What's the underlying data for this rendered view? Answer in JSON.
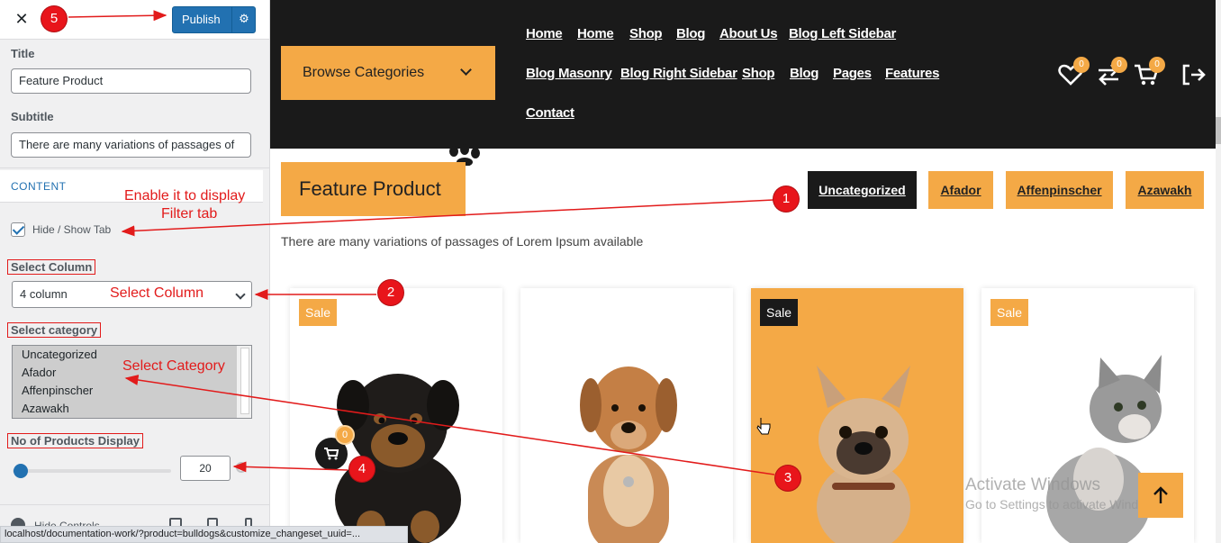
{
  "customizer": {
    "publish_label": "Publish",
    "title_label": "Title",
    "title_value": "Feature Product",
    "subtitle_label": "Subtitle",
    "subtitle_value": "There are many variations of passages of",
    "section_label": "CONTENT",
    "hide_show_tab_label": "Hide / Show Tab",
    "hide_show_tab_checked": true,
    "select_column_label": "Select Column",
    "select_column_value": "4 column",
    "select_category_label": "Select category",
    "categories": [
      "Uncategorized",
      "Afador",
      "Affenpinscher",
      "Azawakh"
    ],
    "products_display_label": "No of Products Display",
    "products_display_value": "20",
    "products_display_slider_fraction": 0.05,
    "hide_controls_label": "Hide Controls"
  },
  "annotations": {
    "badges": [
      "1",
      "2",
      "3",
      "4",
      "5"
    ],
    "enable_tab_line1": "Enable it to display",
    "enable_tab_line2": "Filter tab",
    "select_column_text": "Select Column",
    "select_category_text": "Select Category"
  },
  "status_url": "localhost/documentation-work/?product=bulldogs&customize_changeset_uuid=...",
  "preview": {
    "browse_label": "Browse Categories",
    "nav_row1": [
      "Home",
      "Home",
      "Shop",
      "Blog",
      "About Us",
      "Blog Left Sidebar"
    ],
    "nav_row2": [
      "Blog Masonry",
      "Blog Right Sidebar",
      "Shop",
      "Blog",
      "Pages",
      "Features"
    ],
    "nav_row3": [
      "Contact"
    ],
    "wishlist_count": "0",
    "compare_count": "0",
    "cart_count": "0",
    "section_title": "Feature Product",
    "section_subtitle": "There are many variations of passages of Lorem Ipsum available",
    "tabs": [
      "Uncategorized",
      "Afador",
      "Affenpinscher",
      "Azawakh"
    ],
    "cards": [
      {
        "badge": "Sale",
        "pet": "rottweiler-puppy"
      },
      {
        "badge": "",
        "pet": "brown-dog"
      },
      {
        "badge": "Sale",
        "pet": "french-bulldog"
      },
      {
        "badge": "Sale",
        "pet": "grey-kitten"
      }
    ],
    "cart_badge_count": "0",
    "watermark_line1": "Activate Windows",
    "watermark_line2": "Go to Settings to activate Windows."
  },
  "colors": {
    "accent_orange": "#f4a946",
    "header_dark": "#1a1a1a",
    "wp_blue": "#2271b1",
    "annotation_red": "#e21b1b"
  }
}
